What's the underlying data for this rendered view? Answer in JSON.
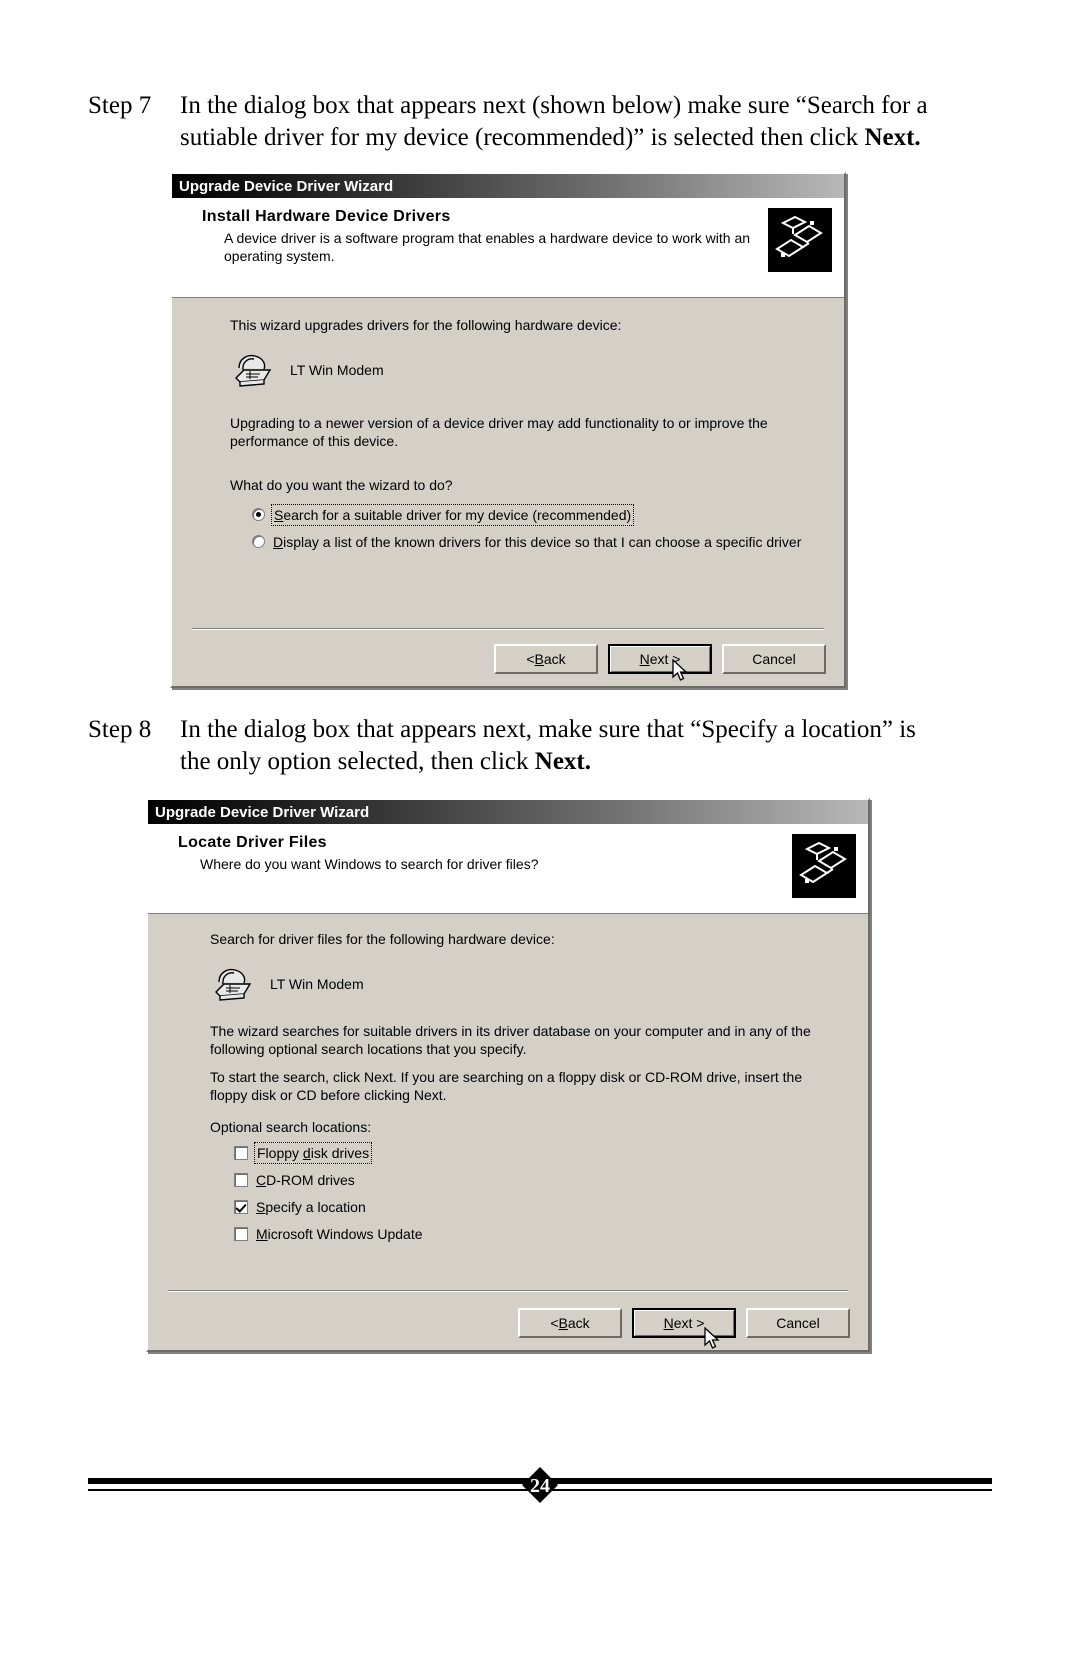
{
  "steps": [
    {
      "label": "Step 7",
      "text_parts": {
        "lead": "In the dialog box that appears next (shown below) make sure “Search for a sutiable driver for my device (recommended)” is selected then click ",
        "bold": "Next."
      }
    },
    {
      "label": "Step 8",
      "text_parts": {
        "lead": "In the dialog box that appears next, make sure that “Specify a location” is the only option selected, then click ",
        "bold": "Next."
      }
    }
  ],
  "dialog1": {
    "title": "Upgrade Device Driver Wizard",
    "banner_title": "Install Hardware Device Drivers",
    "banner_sub": "A device driver is a software program that enables a hardware device to work with an operating system.",
    "intro": "This wizard upgrades drivers for the following hardware device:",
    "device_name": "LT Win Modem",
    "paragraph": "Upgrading to a newer version of a device driver may add functionality to or improve the performance of this device.",
    "question": "What do you want the wizard to do?",
    "options": [
      {
        "accel": "S",
        "rest": "earch for a suitable driver for my device (recommended)",
        "selected": true,
        "focused": true
      },
      {
        "accel": "D",
        "rest": "isplay a list of the known drivers for this device so that I can choose a specific driver",
        "selected": false,
        "focused": false
      }
    ],
    "buttons": {
      "back": {
        "prefix": "< ",
        "accel": "B",
        "rest": "ack",
        "default": false
      },
      "next": {
        "prefix": "",
        "accel": "N",
        "rest": "ext >",
        "default": true
      },
      "cancel": {
        "prefix": "",
        "accel": "",
        "rest": "Cancel",
        "default": false
      }
    }
  },
  "dialog2": {
    "title": "Upgrade Device Driver Wizard",
    "banner_title": "Locate Driver Files",
    "banner_sub": "Where do you want Windows to search for driver files?",
    "intro": "Search for driver files for the following hardware device:",
    "device_name": "LT Win Modem",
    "paragraph1": "The wizard searches for suitable drivers in its driver database on your computer and in any of the following optional search locations that you specify.",
    "paragraph2": "To start the search, click Next. If you are searching on a floppy disk or CD-ROM drive, insert the floppy disk or CD before clicking Next.",
    "group_label": "Optional search locations:",
    "options": [
      {
        "accel_pre": "Floppy ",
        "accel": "d",
        "rest": "isk drives",
        "checked": false,
        "focused": true
      },
      {
        "accel_pre": "",
        "accel": "C",
        "rest": "D-ROM drives",
        "checked": false,
        "focused": false
      },
      {
        "accel_pre": "",
        "accel": "S",
        "rest": "pecify a location",
        "checked": true,
        "focused": false
      },
      {
        "accel_pre": "",
        "accel": "M",
        "rest": "icrosoft Windows Update",
        "checked": false,
        "focused": false
      }
    ],
    "buttons": {
      "back": {
        "prefix": "< ",
        "accel": "B",
        "rest": "ack",
        "default": false
      },
      "next": {
        "prefix": "",
        "accel": "N",
        "rest": "ext >",
        "default": true
      },
      "cancel": {
        "prefix": "",
        "accel": "",
        "rest": "Cancel",
        "default": false
      }
    }
  },
  "footer": {
    "page_number": "24"
  },
  "colors": {
    "dialog_face": "#d4d0c8",
    "titlebar_start": "#000000",
    "titlebar_end": "#b8b8b8",
    "banner_bg": "#ffffff",
    "text": "#000000"
  }
}
